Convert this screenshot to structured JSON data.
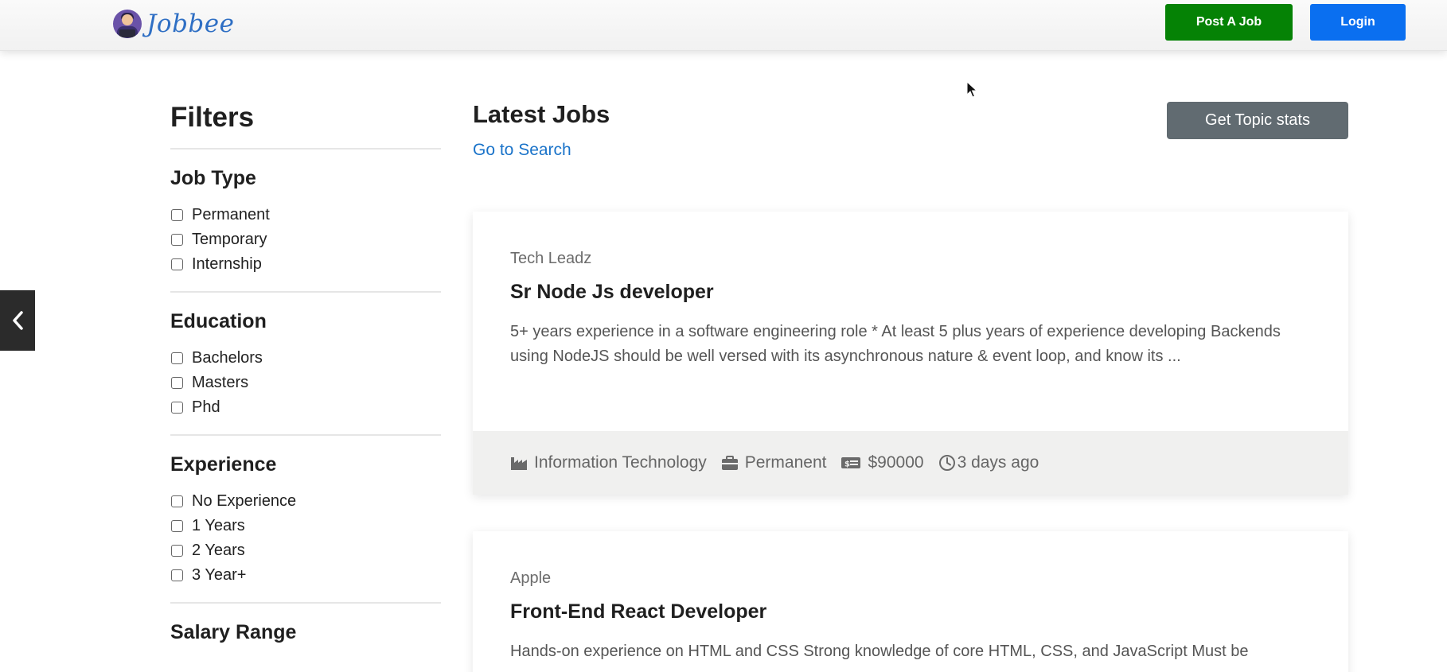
{
  "header": {
    "brand": "Jobbee",
    "post_job": "Post A Job",
    "login": "Login"
  },
  "filters": {
    "title": "Filters",
    "groups": [
      {
        "title": "Job Type",
        "options": [
          "Permanent",
          "Temporary",
          "Internship"
        ]
      },
      {
        "title": "Education",
        "options": [
          "Bachelors",
          "Masters",
          "Phd"
        ]
      },
      {
        "title": "Experience",
        "options": [
          "No Experience",
          "1 Years",
          "2 Years",
          "3 Year+"
        ]
      },
      {
        "title": "Salary Range",
        "options": []
      }
    ]
  },
  "main": {
    "title": "Latest Jobs",
    "go_to_search": "Go to Search",
    "topic_stats": "Get Topic stats"
  },
  "jobs": [
    {
      "company": "Tech Leadz",
      "title": "Sr Node Js developer",
      "description": "5+ years experience in a software engineering role * At least 5 plus years of experience developing Backends using NodeJS should be well versed with its asynchronous nature & event loop, and know its ...",
      "industry": "Information Technology",
      "job_type": "Permanent",
      "salary": "$90000",
      "posted": "3 days ago"
    },
    {
      "company": "Apple",
      "title": "Front-End React Developer",
      "description": "Hands-on experience on HTML and CSS Strong knowledge of core HTML, CSS, and JavaScript Must be"
    }
  ],
  "colors": {
    "post_button": "#058205",
    "login_button": "#0a6ff0",
    "stats_button": "#616b71",
    "link": "#1a73c9"
  },
  "icons": [
    "industry-icon",
    "briefcase-icon",
    "money-icon",
    "clock-icon",
    "chevron-left-icon",
    "mouse-cursor-icon"
  ]
}
